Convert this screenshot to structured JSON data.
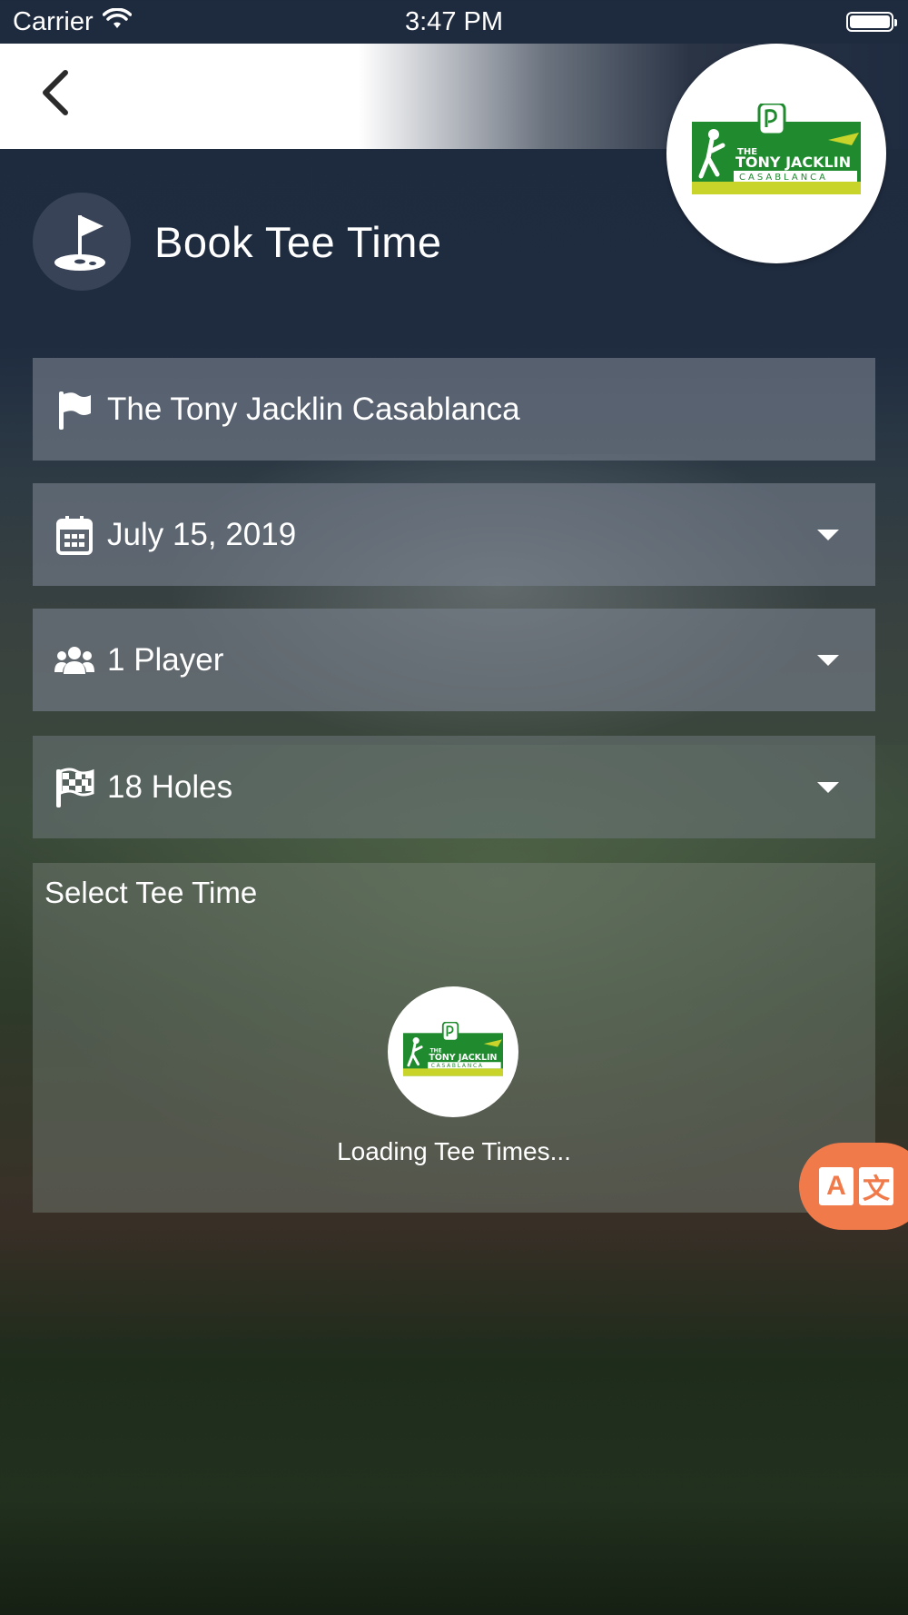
{
  "status_bar": {
    "carrier": "Carrier",
    "time": "3:47 PM"
  },
  "nav": {
    "logo_brand": "THE TONY JACKLIN CASABLANCA"
  },
  "page": {
    "title": "Book Tee Time"
  },
  "fields": {
    "course": "The Tony Jacklin Casablanca",
    "date": "July 15, 2019",
    "players": "1 Player",
    "holes": "18 Holes"
  },
  "tee_times": {
    "title": "Select Tee Time",
    "loading": "Loading Tee Times..."
  },
  "translate": {
    "latin_glyph": "A",
    "cjk_glyph": "文"
  },
  "colors": {
    "accent_orange": "#f07a4a",
    "logo_green": "#1f8a2e",
    "logo_yellow": "#c8d42a"
  },
  "icons": {
    "back": "chevron-left-icon",
    "title": "golf-flag-icon",
    "course": "flag-icon",
    "date": "calendar-icon",
    "players": "users-icon",
    "holes": "checkered-flag-icon",
    "translate": "translate-icon"
  }
}
